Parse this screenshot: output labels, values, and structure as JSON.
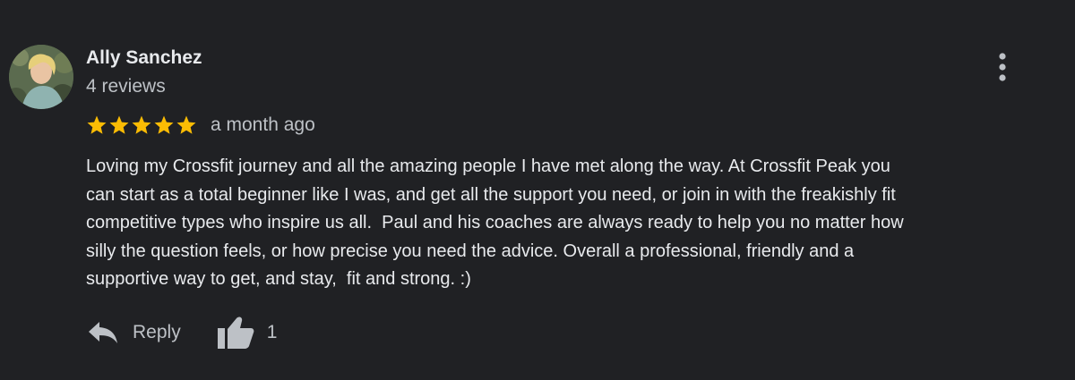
{
  "review": {
    "author": {
      "name": "Ally Sanchez",
      "review_count": "4 reviews",
      "avatar": "profile-photo"
    },
    "rating": {
      "stars": 5,
      "max": 5,
      "star_color": "#fbbc04"
    },
    "date": "a month ago",
    "text": "Loving my Crossfit journey and all the amazing people I have met along the way. At Crossfit Peak you\ncan start as a total beginner like I was, and get all the support you need, or join in with the freakishly fit\ncompetitive types who inspire us all.  Paul and his coaches are always ready to help you no matter how\nsilly the question feels, or how precise you need the advice. Overall a professional, friendly and a\nsupportive way to get, and stay,  fit and strong. :)",
    "actions": {
      "reply_label": "Reply",
      "reply_icon": "reply-arrow-icon",
      "like_icon": "thumbs-up-icon",
      "like_count": "1"
    },
    "menu_icon": "more-vert-icon"
  },
  "theme": {
    "background": "#202124",
    "text_primary": "#e8eaed",
    "text_secondary": "#bdc1c6"
  }
}
